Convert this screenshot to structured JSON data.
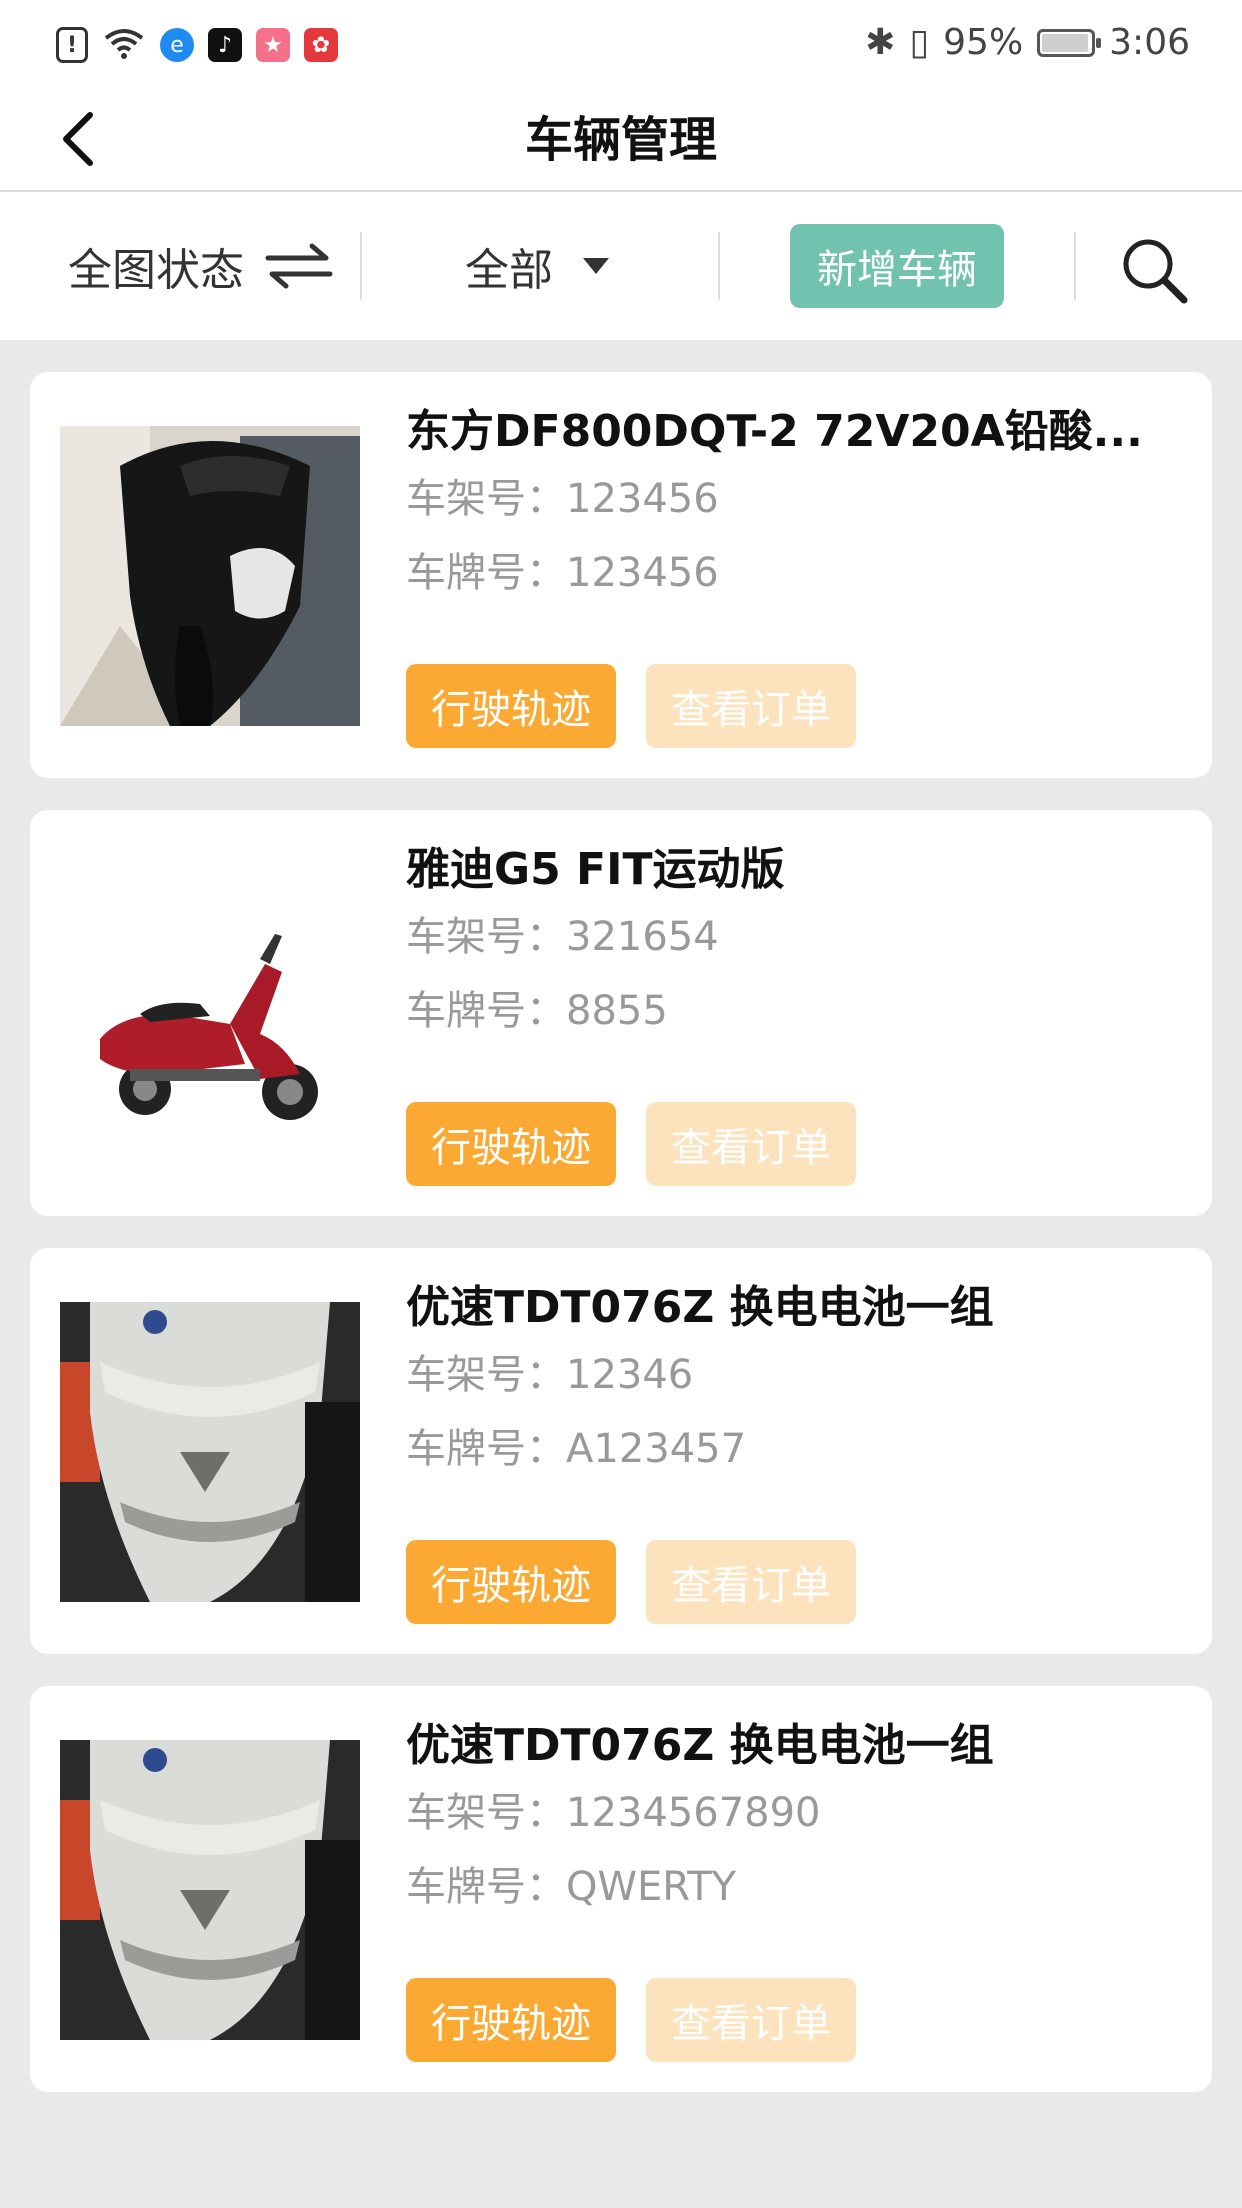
{
  "status_bar": {
    "battery_text": "95%",
    "time": "3:06",
    "battery_level": 0.95
  },
  "header": {
    "title": "车辆管理"
  },
  "toolbar": {
    "map_status_label": "全图状态",
    "filter_label": "全部",
    "add_label": "新增车辆"
  },
  "vehicles": [
    {
      "name": "东方DF800DQT-2 72V20A铅酸...",
      "frame_label": "车架号：",
      "frame_no": "123456",
      "plate_label": "车牌号：",
      "plate_no": "123456",
      "track_label": "行驶轨迹",
      "order_label": "查看订单"
    },
    {
      "name": "雅迪G5 FIT运动版",
      "frame_label": "车架号：",
      "frame_no": "321654",
      "plate_label": "车牌号：",
      "plate_no": "8855",
      "track_label": "行驶轨迹",
      "order_label": "查看订单"
    },
    {
      "name": "优速TDT076Z 换电电池一组",
      "frame_label": "车架号：",
      "frame_no": "12346",
      "plate_label": "车牌号：",
      "plate_no": "A123457",
      "track_label": "行驶轨迹",
      "order_label": "查看订单"
    },
    {
      "name": "优速TDT076Z 换电电池一组",
      "frame_label": "车架号：",
      "frame_no": "1234567890",
      "plate_label": "车牌号：",
      "plate_no": "QWERTY",
      "track_label": "行驶轨迹",
      "order_label": "查看订单"
    }
  ],
  "colors": {
    "accent_green": "#72c2b0",
    "track_orange": "#fba932",
    "order_light": "#fde3bd"
  }
}
